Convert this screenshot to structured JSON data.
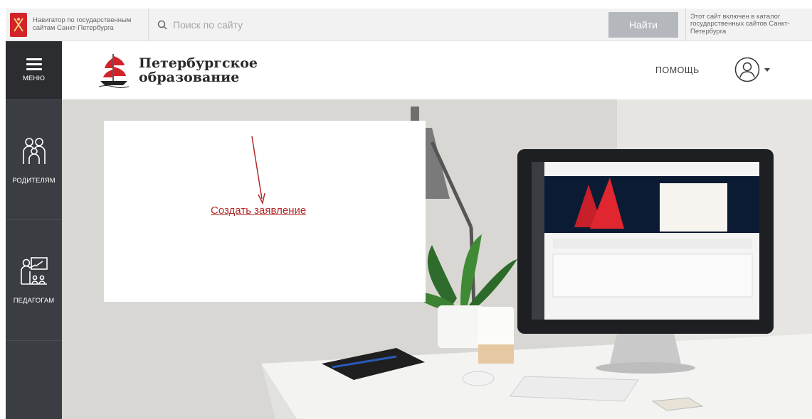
{
  "gov_bar": {
    "navigator_text": "Навигатор по государственным сайтам Санкт-Петербурга",
    "search_placeholder": "Поиск по сайту",
    "find_button": "Найти",
    "catalog_text": "Этот сайт включен в каталог государственных сайтов Санкт-Петербурга"
  },
  "sidenav": {
    "menu_label": "МЕНЮ",
    "items": [
      {
        "label": "РОДИТЕЛЯМ",
        "icon": "parents-icon"
      },
      {
        "label": "ПЕДАГОГАМ",
        "icon": "teacher-icon"
      }
    ]
  },
  "header": {
    "brand_line1": "Петербургское",
    "brand_line2": "образование",
    "help_label": "ПОМОЩЬ",
    "user_icon": "user-icon"
  },
  "card": {
    "create_link": "Создать заявление"
  },
  "colors": {
    "accent_red": "#d2232a",
    "sidebar": "#3a3d42",
    "link": "#b02a2a"
  }
}
